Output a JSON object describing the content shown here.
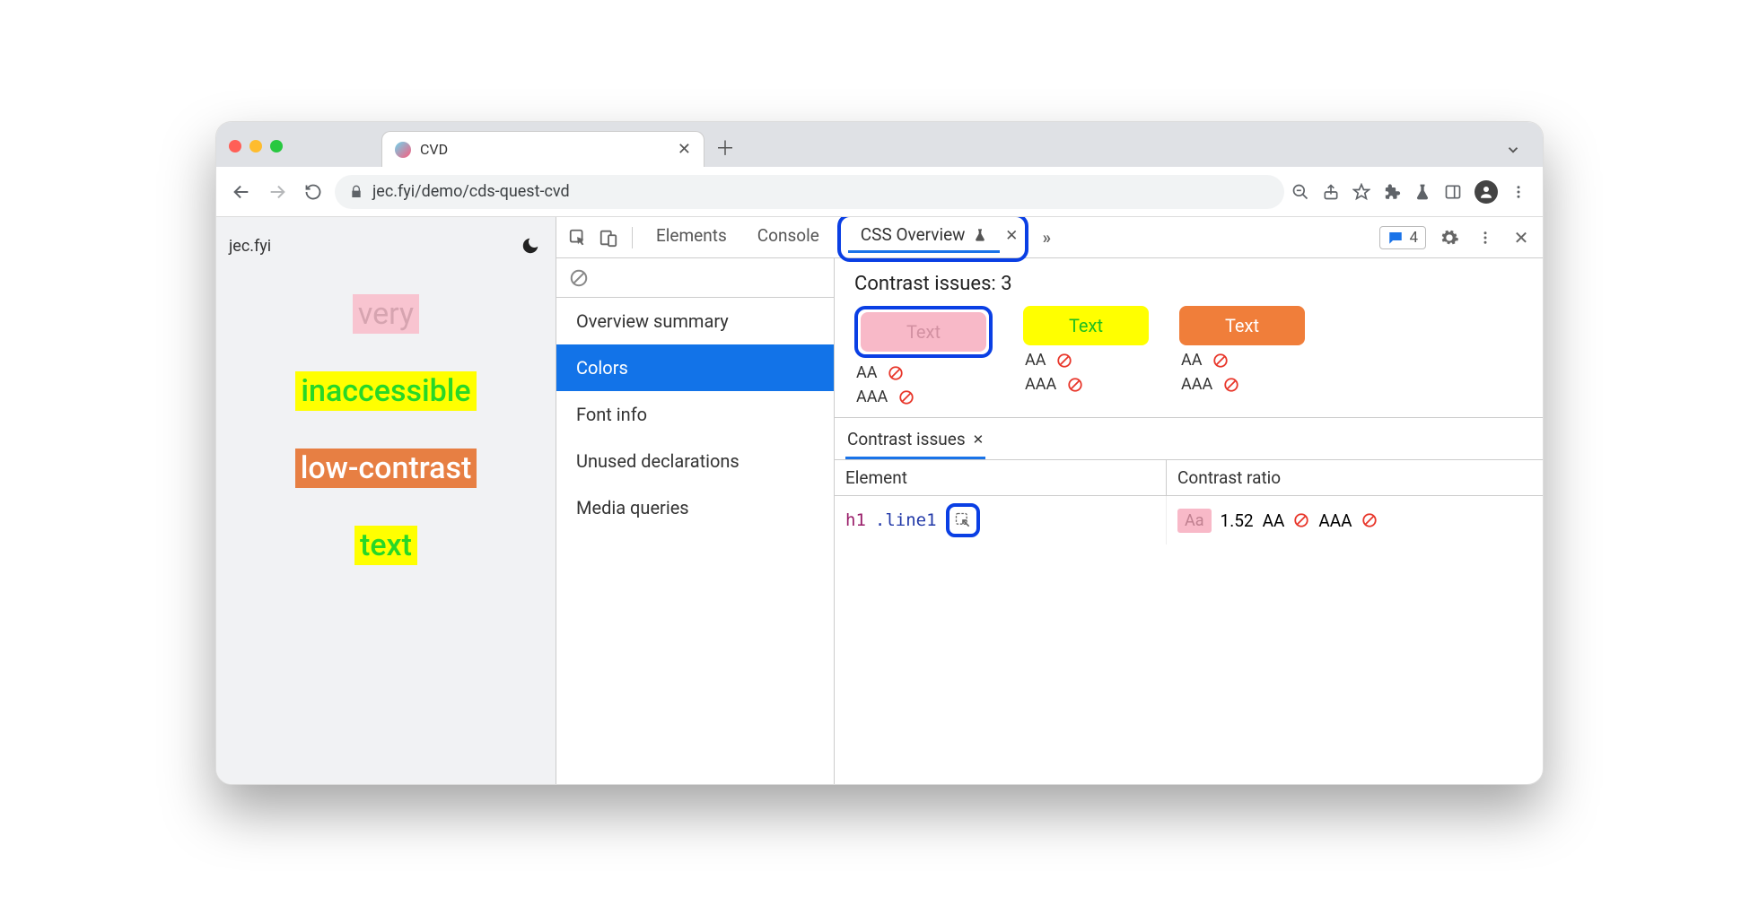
{
  "browser": {
    "tab_title": "CVD",
    "url_display": "jec.fyi/demo/cds-quest-cvd"
  },
  "page": {
    "site_label": "jec.fyi",
    "words": [
      "very",
      "inaccessible",
      "low-contrast",
      "text"
    ]
  },
  "devtools": {
    "tabs": {
      "elements": "Elements",
      "console": "Console",
      "css_overview": "CSS Overview"
    },
    "messages_count": "4",
    "sidebar": {
      "items": [
        "Overview summary",
        "Colors",
        "Font info",
        "Unused declarations",
        "Media queries"
      ],
      "active_index": 1
    },
    "contrast_header": "Contrast issues: 3",
    "swatch_label": "Text",
    "aa_label": "AA",
    "aaa_label": "AAA",
    "sub_tab": "Contrast issues",
    "table": {
      "col_element": "Element",
      "col_ratio": "Contrast ratio",
      "row": {
        "tag": "h1",
        "cls": ".line1",
        "aa_sample": "Aa",
        "ratio": "1.52",
        "aa": "AA",
        "aaa": "AAA"
      }
    }
  },
  "colors": {
    "highlight": "#0a3fe4",
    "primary": "#1a73e8"
  }
}
